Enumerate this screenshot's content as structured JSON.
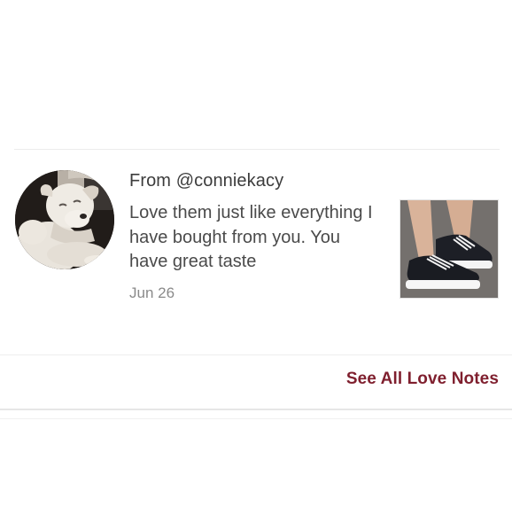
{
  "love_note": {
    "from": "From @conniekacy",
    "body": "Love them just like everything I have bought from you. You have great taste",
    "date": "Jun 26",
    "avatar_icon": "dog-avatar",
    "product_icon": "black-platform-sneakers"
  },
  "footer": {
    "see_all_label": "See All Love Notes"
  },
  "colors": {
    "accent": "#7f1f2e",
    "text_primary": "#3c3c3c",
    "text_secondary": "#8a8a8a",
    "divider": "#ececec"
  }
}
